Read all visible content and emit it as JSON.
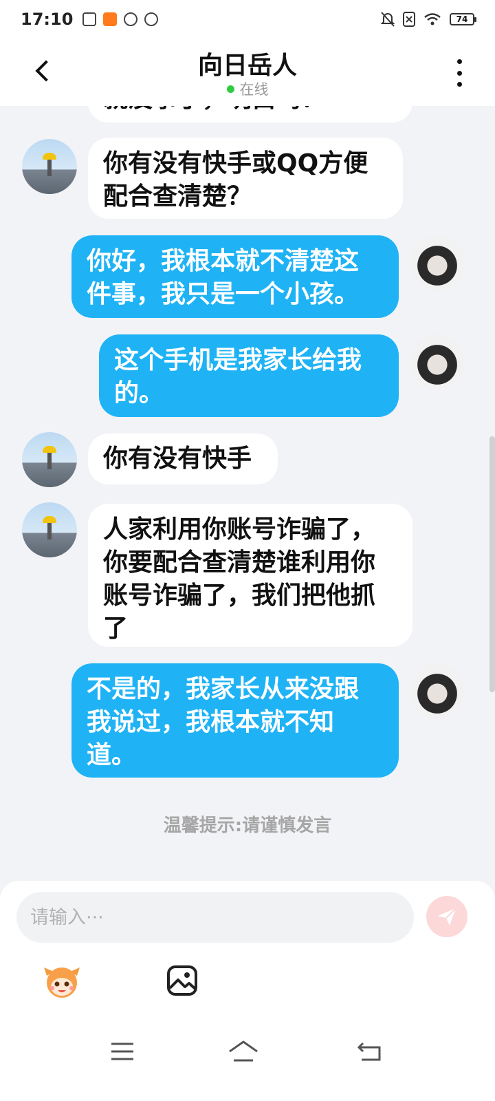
{
  "status_bar": {
    "time": "17:10",
    "battery": "74"
  },
  "header": {
    "title": "向日岳人",
    "status": "在线"
  },
  "messages": [
    {
      "side": "in",
      "text": "就没事了，明白吗？"
    },
    {
      "side": "in",
      "text": "你有没有快手或QQ方便\n配合查清楚？"
    },
    {
      "side": "out",
      "text": "你好，我根本就不清楚这\n件事，我只是一个小孩。"
    },
    {
      "side": "out",
      "text": "这个手机是我家长给我\n的。"
    },
    {
      "side": "in",
      "text": "你有没有快手"
    },
    {
      "side": "in",
      "text": "人家利用你账号诈骗了，\n你要配合查清楚谁利用你\n账号诈骗了，我们把他抓\n了"
    },
    {
      "side": "out",
      "text": "不是的，我家长从来没跟\n我说过，我根本就不知\n道。"
    }
  ],
  "hint": "温馨提示:请谨慎发言",
  "input": {
    "placeholder": "请输入···"
  },
  "colors": {
    "outgoing_bubble": "#1fb3f5",
    "incoming_bubble": "#ffffff",
    "background": "#f2f3f7",
    "online_dot": "#2ecc40",
    "send_button": "#fcd8d8"
  },
  "icons": [
    "back-icon",
    "more-icon",
    "send-icon",
    "emoji-icon",
    "image-icon",
    "menu-icon",
    "home-icon",
    "back-nav-icon"
  ]
}
